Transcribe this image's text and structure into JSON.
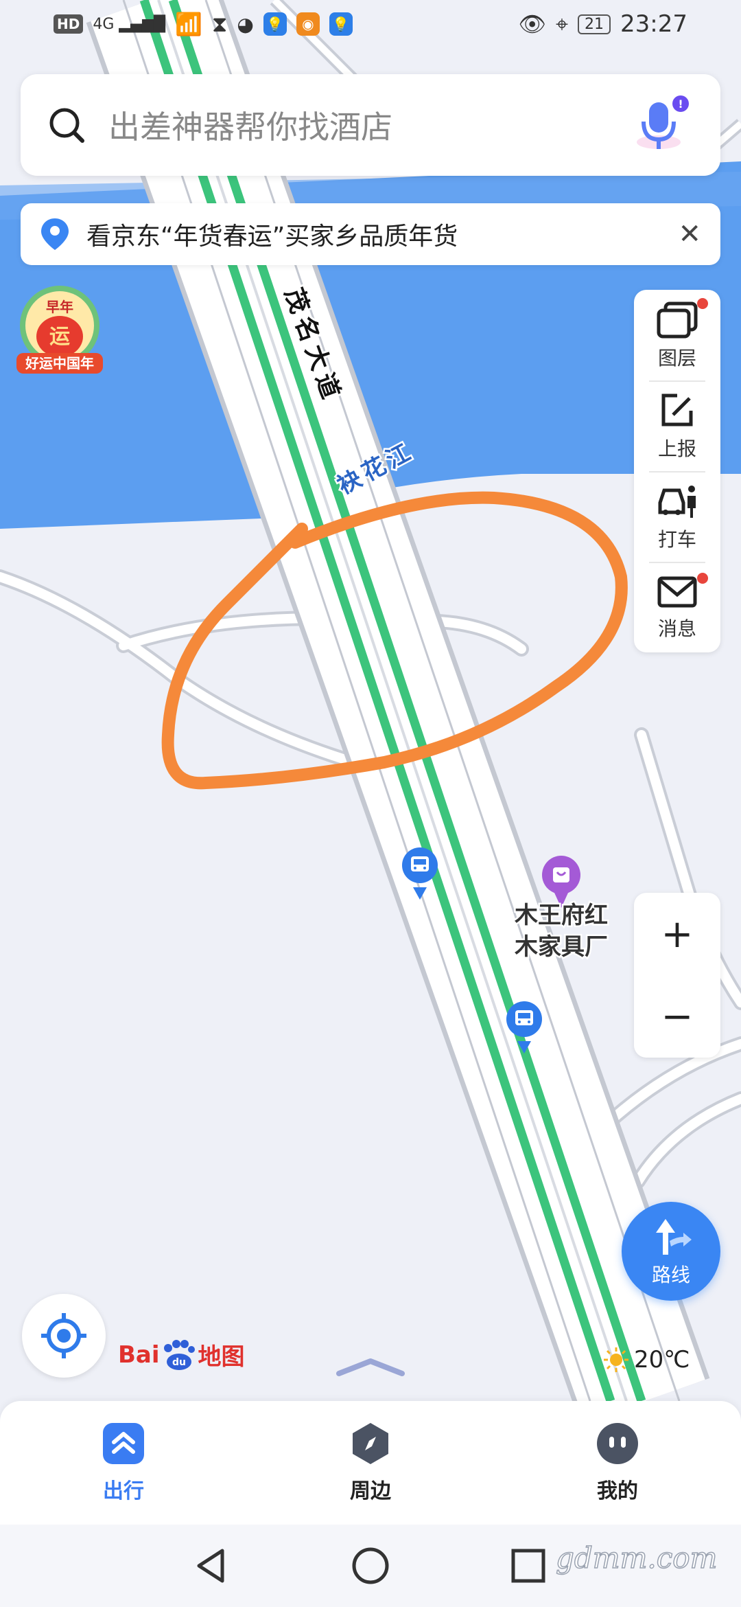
{
  "status_bar": {
    "hd": "HD",
    "network": "4G",
    "time": "23:27",
    "battery": "21",
    "app_icons": [
      "hourglass-icon",
      "wechat-icon",
      "bulb-app-icon",
      "weibo-icon",
      "bulb-app-icon"
    ]
  },
  "search": {
    "placeholder": "出差神器帮你找酒店"
  },
  "notice": {
    "text": "看京东“年货春运”买家乡品质年货"
  },
  "promo": {
    "top_text": "早年",
    "center_text": "运",
    "banner_text": "好运中国年"
  },
  "map": {
    "road_label": "茂名大道",
    "river_label": "袂花江",
    "poi_label_line1": "木王府红",
    "poi_label_line2": "木家具厂",
    "colors": {
      "water": "#5c9ef0",
      "land": "#eef0f7",
      "road": "#ffffff",
      "metro": "#3cc47c",
      "annotation": "#f5893a"
    }
  },
  "right_panel": {
    "layers": "图层",
    "report": "上报",
    "taxi": "打车",
    "messages": "消息"
  },
  "zoom": {
    "in": "+",
    "out": "−"
  },
  "route_button": "路线",
  "logo": {
    "text1": "Bai",
    "text2": "地图"
  },
  "weather": {
    "temp": "20℃"
  },
  "bottom_nav": {
    "items": [
      {
        "label": "出行",
        "icon": "travel-icon",
        "active": true
      },
      {
        "label": "周边",
        "icon": "compass-icon",
        "active": false
      },
      {
        "label": "我的",
        "icon": "profile-icon",
        "active": false
      }
    ]
  },
  "watermark": "gdmm.com"
}
